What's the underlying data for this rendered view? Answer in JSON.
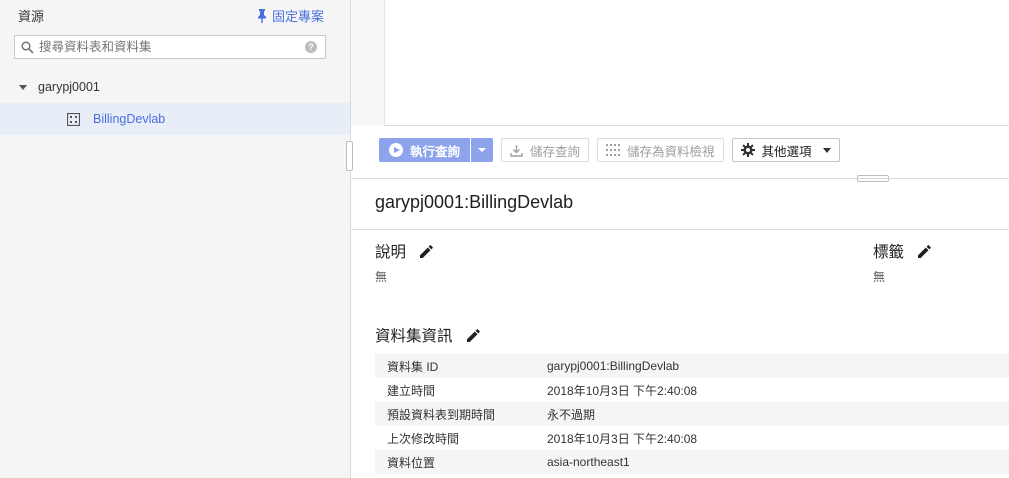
{
  "sidebar": {
    "title": "資源",
    "pin_label": "固定專案",
    "search_placeholder": "搜尋資料表和資料集",
    "help_glyph": "?",
    "project": "garypj0001",
    "dataset": "BillingDevlab"
  },
  "toolbar": {
    "run_label": "執行查詢",
    "save_query_label": "儲存查詢",
    "save_view_label": "儲存為資料檢視",
    "more_label": "其他選項"
  },
  "details": {
    "title": "garypj0001:BillingDevlab",
    "description_heading": "說明",
    "description_value": "無",
    "labels_heading": "標籤",
    "labels_value": "無",
    "info_heading": "資料集資訊",
    "info_rows": [
      {
        "key": "資料集 ID",
        "value": "garypj0001:BillingDevlab"
      },
      {
        "key": "建立時間",
        "value": "2018年10月3日 下午2:40:08"
      },
      {
        "key": "預設資料表到期時間",
        "value": "永不過期"
      },
      {
        "key": "上次修改時間",
        "value": "2018年10月3日 下午2:40:08"
      },
      {
        "key": "資料位置",
        "value": "asia-northeast1"
      }
    ]
  },
  "colors": {
    "accent": "#4a6ee0",
    "run_button": "#8da3ec",
    "selected_row": "#e8eef8"
  },
  "icons": [
    "pin-icon",
    "search-icon",
    "help-icon",
    "caret-down-icon",
    "dataset-icon",
    "play-icon",
    "download-icon",
    "view-grid-icon",
    "gear-icon",
    "pencil-icon"
  ]
}
